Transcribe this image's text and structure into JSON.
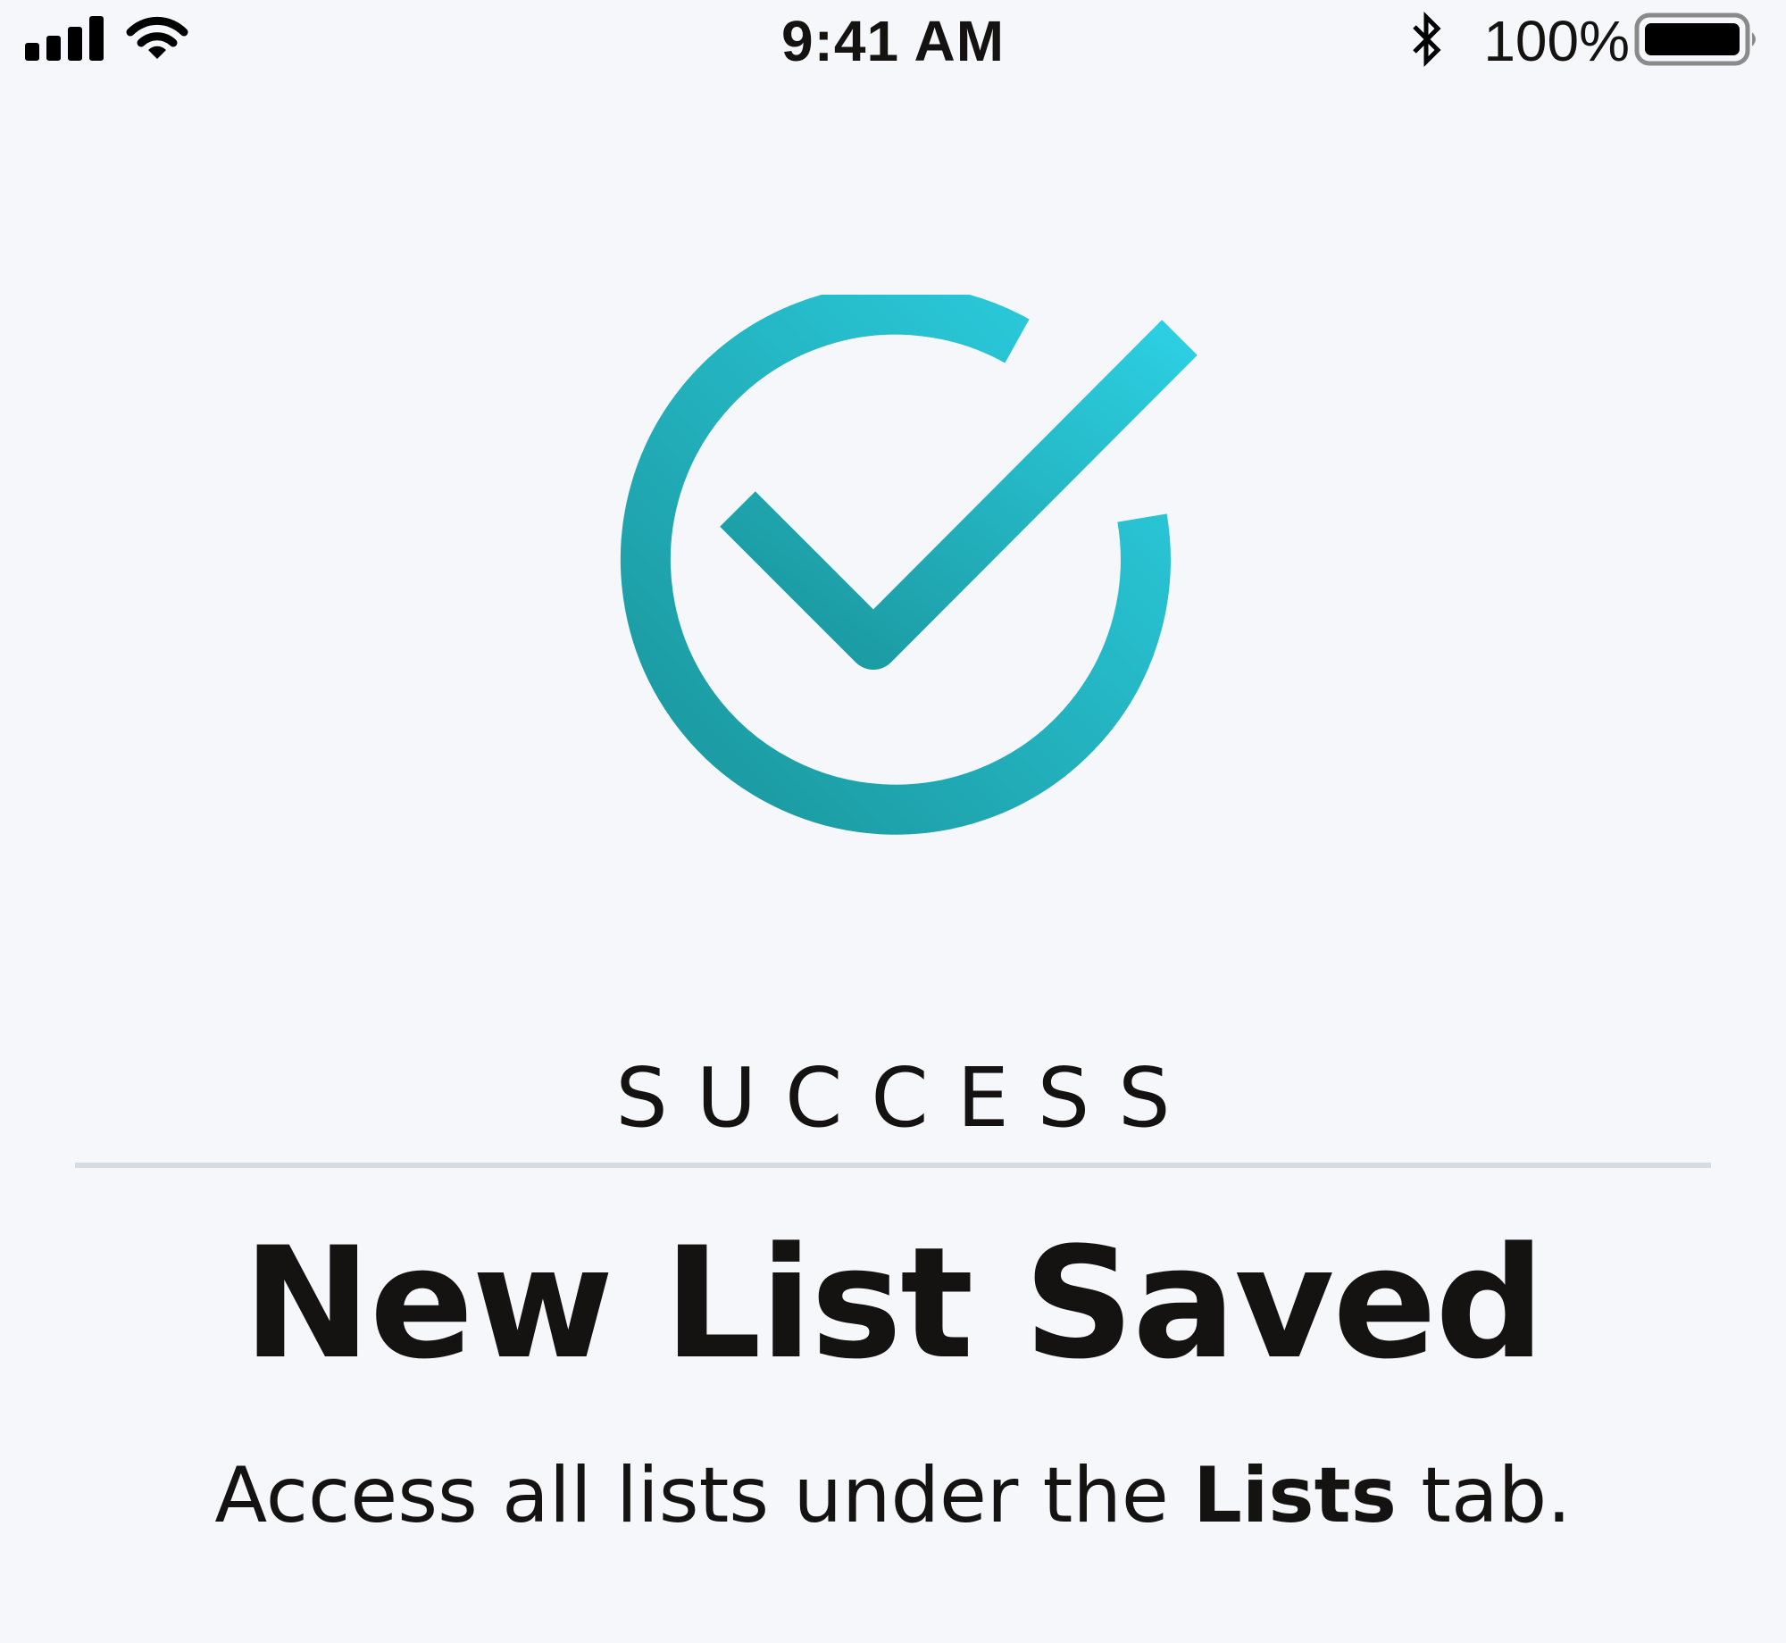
{
  "status_bar": {
    "time": "9:41 AM",
    "battery_percent": "100%",
    "battery_level": 1.0,
    "icons": [
      "signal-icon",
      "wifi-icon",
      "bluetooth-icon",
      "battery-icon"
    ]
  },
  "success_icon": {
    "name": "success-check-icon",
    "gradient_start": "#1a959b",
    "gradient_end": "#2ccfe2"
  },
  "content": {
    "eyebrow": "SUCCESS",
    "headline": "New List Saved",
    "message_before": "Access all lists under the ",
    "message_bold": "Lists",
    "message_after": " tab."
  },
  "colors": {
    "background": "#f5f7fb",
    "text": "#151311",
    "divider": "#d6dbe1"
  }
}
